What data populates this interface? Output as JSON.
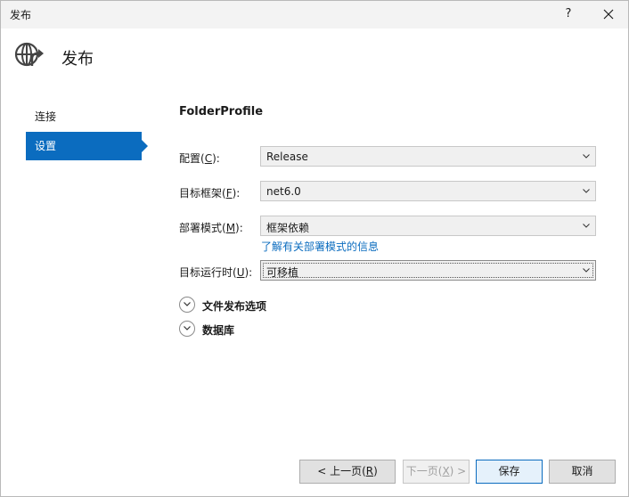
{
  "window": {
    "title": "发布",
    "help": "?"
  },
  "header": {
    "title": "发布"
  },
  "nav": {
    "items": [
      {
        "label": "连接"
      },
      {
        "label": "设置"
      }
    ]
  },
  "profile": {
    "name": "FolderProfile"
  },
  "form": {
    "config": {
      "label": "配置(",
      "key": "C",
      "suffix": "):",
      "value": "Release"
    },
    "framework": {
      "label": "目标框架(",
      "key": "F",
      "suffix": "):",
      "value": "net6.0"
    },
    "deploy": {
      "label": "部署模式(",
      "key": "M",
      "suffix": "):",
      "value": "框架依赖"
    },
    "deploy_link": "了解有关部署模式的信息",
    "runtime": {
      "label": "目标运行时(",
      "key": "U",
      "suffix": "):",
      "value": "可移植"
    }
  },
  "sections": [
    {
      "label": "文件发布选项"
    },
    {
      "label": "数据库"
    }
  ],
  "buttons": {
    "prev": {
      "pre": "< 上一页(",
      "key": "R",
      "post": ")"
    },
    "next": {
      "pre": "下一页(",
      "key": "X",
      "post": ") >"
    },
    "save": "保存",
    "cancel": "取消"
  }
}
